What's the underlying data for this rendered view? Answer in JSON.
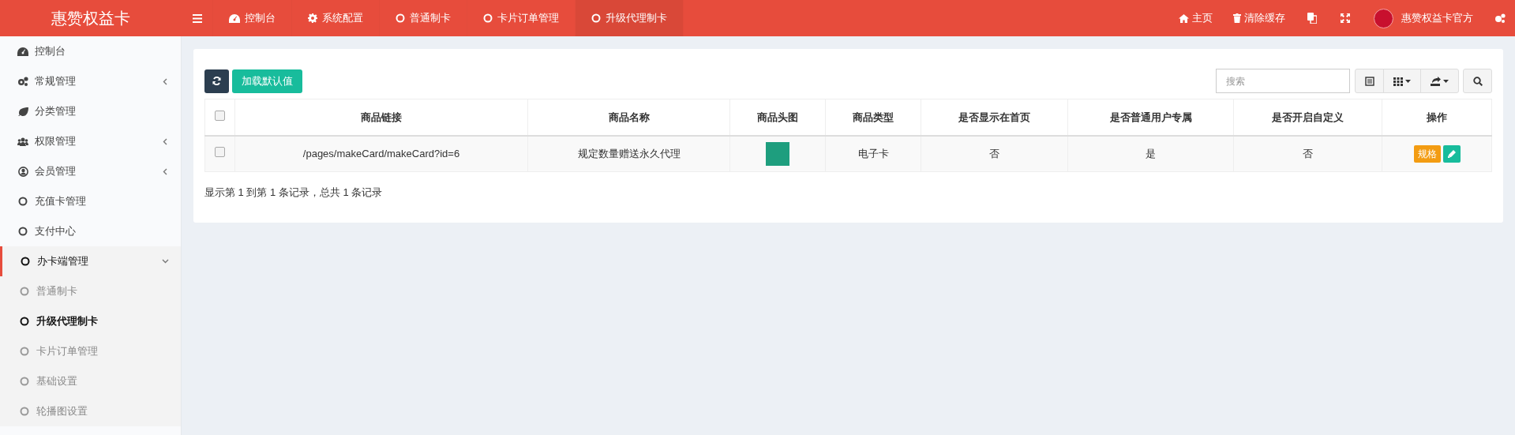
{
  "header": {
    "brand": "惠赞权益卡",
    "nav_tabs": [
      {
        "label": "控制台",
        "selected": false
      },
      {
        "label": "系统配置",
        "selected": false
      },
      {
        "label": "普通制卡",
        "selected": false
      },
      {
        "label": "卡片订单管理",
        "selected": false
      },
      {
        "label": "升级代理制卡",
        "selected": true
      }
    ],
    "right_links": [
      {
        "label": "主页"
      },
      {
        "label": "清除缓存"
      }
    ],
    "user": {
      "name": "惠赞权益卡官方"
    }
  },
  "sidebar": {
    "items": [
      {
        "label": "控制台",
        "kind": "item"
      },
      {
        "label": "常规管理",
        "kind": "group",
        "expanded": false
      },
      {
        "label": "分类管理",
        "kind": "item"
      },
      {
        "label": "权限管理",
        "kind": "group",
        "expanded": false
      },
      {
        "label": "会员管理",
        "kind": "group",
        "expanded": false
      },
      {
        "label": "充值卡管理",
        "kind": "item"
      },
      {
        "label": "支付中心",
        "kind": "item"
      },
      {
        "label": "办卡端管理",
        "kind": "group",
        "expanded": true,
        "children": [
          {
            "label": "普通制卡",
            "selected": false
          },
          {
            "label": "升级代理制卡",
            "selected": true
          },
          {
            "label": "卡片订单管理",
            "selected": false
          },
          {
            "label": "基础设置",
            "selected": false
          },
          {
            "label": "轮播图设置",
            "selected": false
          }
        ]
      }
    ]
  },
  "toolbar": {
    "load_default_button": "加载默认值",
    "search": {
      "placeholder": "搜索"
    }
  },
  "table": {
    "columns": [
      "商品链接",
      "商品名称",
      "商品头图",
      "商品类型",
      "是否显示在首页",
      "是否普通用户专属",
      "是否开启自定义",
      "操作"
    ],
    "header_checked": false,
    "rows": [
      {
        "checked": false,
        "cells": [
          "/pages/makeCard/makeCard?id=6",
          "规定数量赠送永久代理",
          "",
          "电子卡",
          "否",
          "是",
          "否"
        ],
        "actions": [
          "规格"
        ]
      }
    ]
  },
  "pagination_info": "显示第 1 到第 1 条记录，总共 1 条记录"
}
